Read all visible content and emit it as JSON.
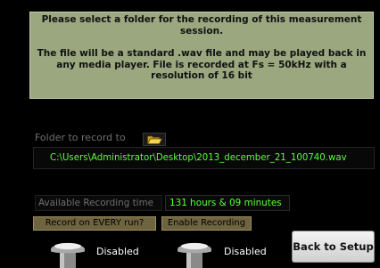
{
  "info_panel": {
    "line1": "Please select a folder for the recording of this measurement session.",
    "line2": "The file will be a standard .wav file and may be played back in any media player. File is recorded at Fs = 50kHz with a resolution of 16 bit"
  },
  "folder": {
    "label": "Folder to record to",
    "icon": "folder-open-icon",
    "path": "C:\\Users\\Administrator\\Desktop\\2013_december_21_100740.wav"
  },
  "recording_time": {
    "label": "Available Recording time",
    "value": "131 hours & 09 minutes"
  },
  "toggles": {
    "record_every_run": "Record on EVERY run?",
    "enable_recording": "Enable Recording"
  },
  "switches": {
    "switch1_status": "Disabled",
    "switch2_status": "Disabled"
  },
  "back_button": {
    "label": "Back to Setup"
  },
  "colors": {
    "panel_bg": "#9aa77f",
    "value_text": "#5aff3a",
    "toggle_bg": "#6e6440"
  }
}
